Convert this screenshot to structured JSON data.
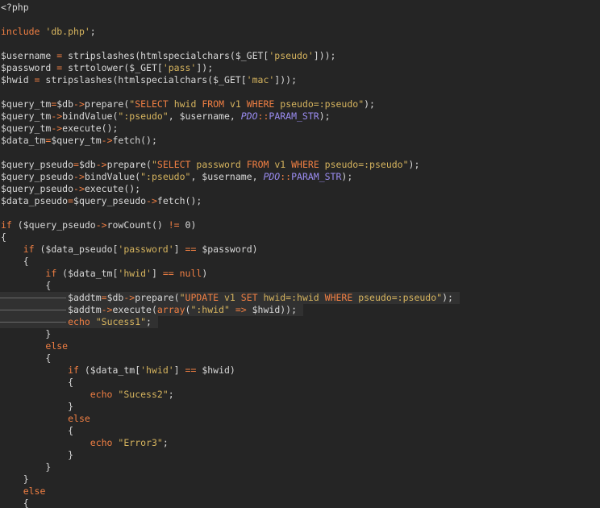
{
  "editor": {
    "language": "php",
    "colors": {
      "background": "#252525",
      "text": "#d8d8d8",
      "keyword": "#f07f43",
      "string": "#d6b45e",
      "class": "#9a8cf0",
      "current_line": "#313131"
    },
    "lines": [
      [
        {
          "t": "<?php",
          "c": "default"
        }
      ],
      [],
      [
        {
          "t": "include",
          "c": "keyword"
        },
        {
          "t": " ",
          "c": "default"
        },
        {
          "t": "'db.php'",
          "c": "string"
        },
        {
          "t": ";",
          "c": "default"
        }
      ],
      [],
      [
        {
          "t": "$username ",
          "c": "default"
        },
        {
          "t": "=",
          "c": "op"
        },
        {
          "t": " stripslashes(htmlspecialchars($_GET[",
          "c": "default"
        },
        {
          "t": "'pseudo'",
          "c": "string"
        },
        {
          "t": "]));",
          "c": "default"
        }
      ],
      [
        {
          "t": "$password ",
          "c": "default"
        },
        {
          "t": "=",
          "c": "op"
        },
        {
          "t": " strtolower($_GET[",
          "c": "default"
        },
        {
          "t": "'pass'",
          "c": "string"
        },
        {
          "t": "]);",
          "c": "default"
        }
      ],
      [
        {
          "t": "$hwid ",
          "c": "default"
        },
        {
          "t": "=",
          "c": "op"
        },
        {
          "t": " stripslashes(htmlspecialchars($_GET[",
          "c": "default"
        },
        {
          "t": "'mac'",
          "c": "string"
        },
        {
          "t": "]));",
          "c": "default"
        }
      ],
      [],
      [
        {
          "t": "$query_tm",
          "c": "default"
        },
        {
          "t": "=",
          "c": "op"
        },
        {
          "t": "$db",
          "c": "default"
        },
        {
          "t": "->",
          "c": "op"
        },
        {
          "t": "prepare(",
          "c": "default"
        },
        {
          "t": "\"",
          "c": "string"
        },
        {
          "t": "SELECT",
          "c": "sqlkw"
        },
        {
          "t": " hwid ",
          "c": "string"
        },
        {
          "t": "FROM",
          "c": "sqlkw"
        },
        {
          "t": " v1 ",
          "c": "string"
        },
        {
          "t": "WHERE",
          "c": "sqlkw"
        },
        {
          "t": " pseudo=:pseudo\"",
          "c": "string"
        },
        {
          "t": ");",
          "c": "default"
        }
      ],
      [
        {
          "t": "$query_tm",
          "c": "default"
        },
        {
          "t": "->",
          "c": "op"
        },
        {
          "t": "bindValue(",
          "c": "default"
        },
        {
          "t": "\":pseudo\"",
          "c": "string"
        },
        {
          "t": ", $username, ",
          "c": "default"
        },
        {
          "t": "PDO",
          "c": "class"
        },
        {
          "t": "::",
          "c": "op"
        },
        {
          "t": "PARAM_STR",
          "c": "const"
        },
        {
          "t": ");",
          "c": "default"
        }
      ],
      [
        {
          "t": "$query_tm",
          "c": "default"
        },
        {
          "t": "->",
          "c": "op"
        },
        {
          "t": "execute();",
          "c": "default"
        }
      ],
      [
        {
          "t": "$data_tm",
          "c": "default"
        },
        {
          "t": "=",
          "c": "op"
        },
        {
          "t": "$query_tm",
          "c": "default"
        },
        {
          "t": "->",
          "c": "op"
        },
        {
          "t": "fetch();",
          "c": "default"
        }
      ],
      [],
      [
        {
          "t": "$query_pseudo",
          "c": "default"
        },
        {
          "t": "=",
          "c": "op"
        },
        {
          "t": "$db",
          "c": "default"
        },
        {
          "t": "->",
          "c": "op"
        },
        {
          "t": "prepare(",
          "c": "default"
        },
        {
          "t": "\"",
          "c": "string"
        },
        {
          "t": "SELECT",
          "c": "sqlkw"
        },
        {
          "t": " password ",
          "c": "string"
        },
        {
          "t": "FROM",
          "c": "sqlkw"
        },
        {
          "t": " v1 ",
          "c": "string"
        },
        {
          "t": "WHERE",
          "c": "sqlkw"
        },
        {
          "t": " pseudo=:pseudo\"",
          "c": "string"
        },
        {
          "t": ");",
          "c": "default"
        }
      ],
      [
        {
          "t": "$query_pseudo",
          "c": "default"
        },
        {
          "t": "->",
          "c": "op"
        },
        {
          "t": "bindValue(",
          "c": "default"
        },
        {
          "t": "\":pseudo\"",
          "c": "string"
        },
        {
          "t": ", $username, ",
          "c": "default"
        },
        {
          "t": "PDO",
          "c": "class"
        },
        {
          "t": "::",
          "c": "op"
        },
        {
          "t": "PARAM_STR",
          "c": "const"
        },
        {
          "t": ");",
          "c": "default"
        }
      ],
      [
        {
          "t": "$query_pseudo",
          "c": "default"
        },
        {
          "t": "->",
          "c": "op"
        },
        {
          "t": "execute();",
          "c": "default"
        }
      ],
      [
        {
          "t": "$data_pseudo",
          "c": "default"
        },
        {
          "t": "=",
          "c": "op"
        },
        {
          "t": "$query_pseudo",
          "c": "default"
        },
        {
          "t": "->",
          "c": "op"
        },
        {
          "t": "fetch();",
          "c": "default"
        }
      ],
      [],
      [
        {
          "t": "if",
          "c": "keyword"
        },
        {
          "t": " ($query_pseudo",
          "c": "default"
        },
        {
          "t": "->",
          "c": "op"
        },
        {
          "t": "rowCount() ",
          "c": "default"
        },
        {
          "t": "!=",
          "c": "op"
        },
        {
          "t": " 0)",
          "c": "default"
        }
      ],
      [
        {
          "t": "{",
          "c": "default"
        }
      ],
      [
        {
          "t": "    ",
          "c": "default"
        },
        {
          "t": "if",
          "c": "keyword"
        },
        {
          "t": " ($data_pseudo[",
          "c": "default"
        },
        {
          "t": "'password'",
          "c": "string"
        },
        {
          "t": "] ",
          "c": "default"
        },
        {
          "t": "==",
          "c": "op"
        },
        {
          "t": " $password)",
          "c": "default"
        }
      ],
      [
        {
          "t": "    {",
          "c": "default"
        }
      ],
      [
        {
          "t": "        ",
          "c": "default"
        },
        {
          "t": "if",
          "c": "keyword"
        },
        {
          "t": " ($data_tm[",
          "c": "default"
        },
        {
          "t": "'hwid'",
          "c": "string"
        },
        {
          "t": "] ",
          "c": "default"
        },
        {
          "t": "==",
          "c": "op"
        },
        {
          "t": " ",
          "c": "default"
        },
        {
          "t": "null",
          "c": "keyword"
        },
        {
          "t": ")",
          "c": "default"
        }
      ],
      [
        {
          "t": "        {",
          "c": "default"
        }
      ],
      [
        {
          "t": "            $addtm",
          "c": "default"
        },
        {
          "t": "=",
          "c": "op"
        },
        {
          "t": "$db",
          "c": "default"
        },
        {
          "t": "->",
          "c": "op"
        },
        {
          "t": "prepare(",
          "c": "default"
        },
        {
          "t": "\"",
          "c": "string"
        },
        {
          "t": "UPDATE",
          "c": "sqlkw"
        },
        {
          "t": " v1 ",
          "c": "string"
        },
        {
          "t": "SET",
          "c": "sqlkw"
        },
        {
          "t": " hwid=:hwid ",
          "c": "string"
        },
        {
          "t": "WHERE",
          "c": "sqlkw"
        },
        {
          "t": " pseudo=:pseudo\"",
          "c": "string"
        },
        {
          "t": ");",
          "c": "default"
        }
      ],
      [
        {
          "t": "            $addtm",
          "c": "default"
        },
        {
          "t": "->",
          "c": "op"
        },
        {
          "t": "execute(",
          "c": "default"
        },
        {
          "t": "array",
          "c": "keyword"
        },
        {
          "t": "(",
          "c": "default"
        },
        {
          "t": "\":hwid\"",
          "c": "string"
        },
        {
          "t": " ",
          "c": "default"
        },
        {
          "t": "=>",
          "c": "op"
        },
        {
          "t": " $hwid));",
          "c": "default"
        }
      ],
      [
        {
          "t": "            ",
          "c": "default"
        },
        {
          "t": "echo",
          "c": "keyword"
        },
        {
          "t": " ",
          "c": "default"
        },
        {
          "t": "\"Sucess1\"",
          "c": "string"
        },
        {
          "t": ";",
          "c": "default"
        }
      ],
      [
        {
          "t": "        }",
          "c": "default"
        }
      ],
      [
        {
          "t": "        ",
          "c": "default"
        },
        {
          "t": "else",
          "c": "keyword"
        }
      ],
      [
        {
          "t": "        {",
          "c": "default"
        }
      ],
      [
        {
          "t": "            ",
          "c": "default"
        },
        {
          "t": "if",
          "c": "keyword"
        },
        {
          "t": " ($data_tm[",
          "c": "default"
        },
        {
          "t": "'hwid'",
          "c": "string"
        },
        {
          "t": "] ",
          "c": "default"
        },
        {
          "t": "==",
          "c": "op"
        },
        {
          "t": " $hwid)",
          "c": "default"
        }
      ],
      [
        {
          "t": "            {",
          "c": "default"
        }
      ],
      [
        {
          "t": "                ",
          "c": "default"
        },
        {
          "t": "echo",
          "c": "keyword"
        },
        {
          "t": " ",
          "c": "default"
        },
        {
          "t": "\"Sucess2\"",
          "c": "string"
        },
        {
          "t": ";",
          "c": "default"
        }
      ],
      [
        {
          "t": "            }",
          "c": "default"
        }
      ],
      [
        {
          "t": "            ",
          "c": "default"
        },
        {
          "t": "else",
          "c": "keyword"
        }
      ],
      [
        {
          "t": "            {",
          "c": "default"
        }
      ],
      [
        {
          "t": "                ",
          "c": "default"
        },
        {
          "t": "echo",
          "c": "keyword"
        },
        {
          "t": " ",
          "c": "default"
        },
        {
          "t": "\"Error3\"",
          "c": "string"
        },
        {
          "t": ";",
          "c": "default"
        }
      ],
      [
        {
          "t": "            }",
          "c": "default"
        }
      ],
      [
        {
          "t": "        }",
          "c": "default"
        }
      ],
      [
        {
          "t": "    }",
          "c": "default"
        }
      ],
      [
        {
          "t": "    ",
          "c": "default"
        },
        {
          "t": "else",
          "c": "keyword"
        }
      ],
      [
        {
          "t": "    {",
          "c": "default"
        }
      ]
    ],
    "highlighted_lines": [
      24,
      25,
      26
    ]
  }
}
